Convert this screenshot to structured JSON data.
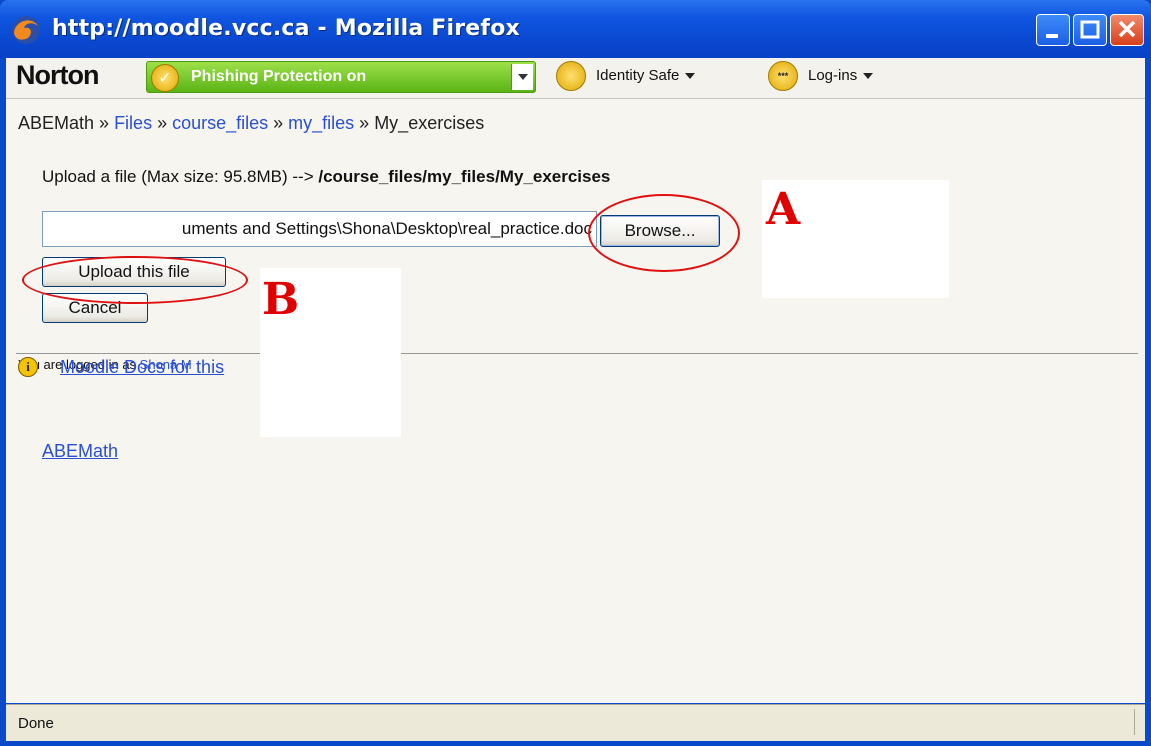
{
  "window": {
    "title": "http://moodle.vcc.ca - Mozilla Firefox"
  },
  "norton_toolbar": {
    "logo": "Norton",
    "phishing_label": "Phishing Protection on",
    "identity_safe_label": "Identity Safe",
    "logins_label": "Log-ins",
    "logins_icon_text": "***"
  },
  "breadcrumb": {
    "root": "ABEMath",
    "sep": " » ",
    "items": [
      "Files",
      "course_files",
      "my_files"
    ],
    "current": "My_exercises"
  },
  "upload": {
    "info_prefix": "Upload a file (Max size: 95.8MB) --> ",
    "info_path": "/course_files/my_files/My_exercises",
    "file_value": "uments and Settings\\Shona\\Desktop\\real_practice.doc",
    "browse_label": "Browse...",
    "upload_label": "Upload this file",
    "cancel_label": "Cancel"
  },
  "footer": {
    "docs_link": "Moodle Docs for this",
    "logged_in_prefix": "You are logged in as ",
    "logged_in_user": "Shona M",
    "home_link": "ABEMath"
  },
  "annotations": {
    "a_label": "A",
    "b_label": "B",
    "color": "#e00000"
  },
  "statusbar": {
    "text": "Done"
  }
}
